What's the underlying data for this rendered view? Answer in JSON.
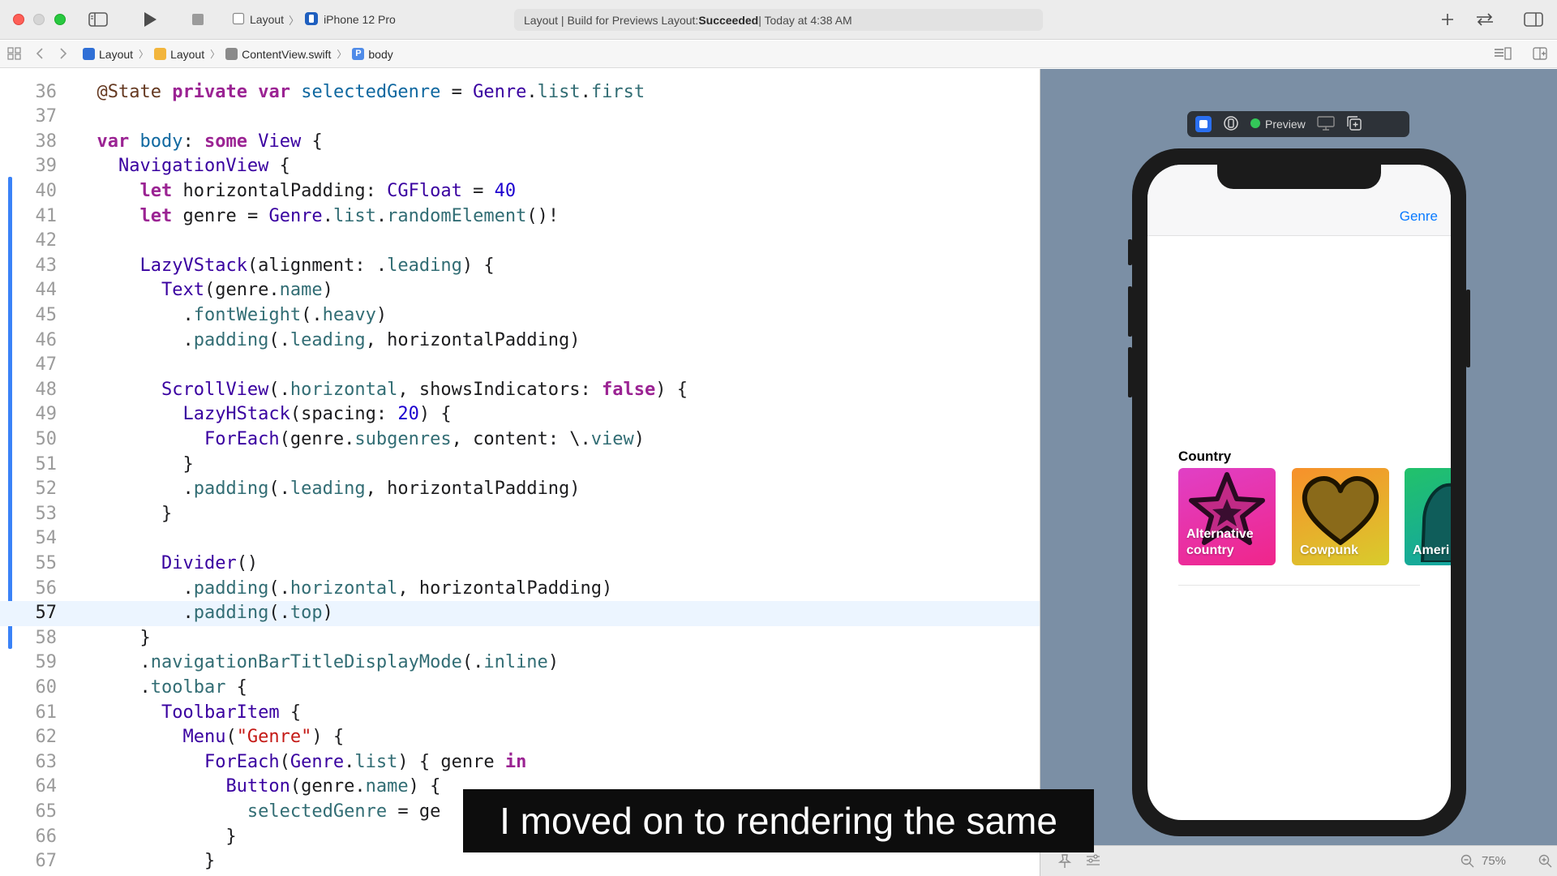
{
  "toolbar": {
    "scheme_project": "Layout",
    "scheme_device": "iPhone 12 Pro",
    "activity_prefix": "Layout | Build for Previews Layout: ",
    "activity_status": "Succeeded",
    "activity_suffix": " | Today at 4:38 AM"
  },
  "breadcrumb": {
    "project": "Layout",
    "folder": "Layout",
    "file": "ContentView.swift",
    "symbol": "body"
  },
  "editor": {
    "current_line": "57",
    "lines": [
      {
        "num": "36",
        "tokens": [
          {
            "t": "  "
          },
          {
            "t": "@State",
            "c": "attr"
          },
          {
            "t": " "
          },
          {
            "t": "private",
            "c": "kw"
          },
          {
            "t": " "
          },
          {
            "t": "var",
            "c": "kw"
          },
          {
            "t": " "
          },
          {
            "t": "selectedGenre",
            "c": "decl"
          },
          {
            "t": " = "
          },
          {
            "t": "Genre",
            "c": "type"
          },
          {
            "t": "."
          },
          {
            "t": "list",
            "c": "prop"
          },
          {
            "t": "."
          },
          {
            "t": "first",
            "c": "prop"
          }
        ]
      },
      {
        "num": "37",
        "tokens": []
      },
      {
        "num": "38",
        "tokens": [
          {
            "t": "  "
          },
          {
            "t": "var",
            "c": "kw"
          },
          {
            "t": " "
          },
          {
            "t": "body",
            "c": "decl"
          },
          {
            "t": ": "
          },
          {
            "t": "some",
            "c": "kw"
          },
          {
            "t": " "
          },
          {
            "t": "View",
            "c": "type"
          },
          {
            "t": " {"
          }
        ]
      },
      {
        "num": "39",
        "tokens": [
          {
            "t": "    "
          },
          {
            "t": "NavigationView",
            "c": "type"
          },
          {
            "t": " {"
          }
        ]
      },
      {
        "num": "40",
        "tokens": [
          {
            "t": "      "
          },
          {
            "t": "let",
            "c": "kw"
          },
          {
            "t": " horizontalPadding: "
          },
          {
            "t": "CGFloat",
            "c": "type"
          },
          {
            "t": " = "
          },
          {
            "t": "40",
            "c": "num"
          }
        ]
      },
      {
        "num": "41",
        "tokens": [
          {
            "t": "      "
          },
          {
            "t": "let",
            "c": "kw"
          },
          {
            "t": " genre = "
          },
          {
            "t": "Genre",
            "c": "type"
          },
          {
            "t": "."
          },
          {
            "t": "list",
            "c": "prop"
          },
          {
            "t": "."
          },
          {
            "t": "randomElement",
            "c": "fn"
          },
          {
            "t": "()!"
          }
        ]
      },
      {
        "num": "42",
        "tokens": []
      },
      {
        "num": "43",
        "tokens": [
          {
            "t": "      "
          },
          {
            "t": "LazyVStack",
            "c": "type"
          },
          {
            "t": "(alignment: ."
          },
          {
            "t": "leading",
            "c": "prop"
          },
          {
            "t": ") {"
          }
        ]
      },
      {
        "num": "44",
        "tokens": [
          {
            "t": "        "
          },
          {
            "t": "Text",
            "c": "type"
          },
          {
            "t": "(genre."
          },
          {
            "t": "name",
            "c": "prop"
          },
          {
            "t": ")"
          }
        ]
      },
      {
        "num": "45",
        "tokens": [
          {
            "t": "          ."
          },
          {
            "t": "fontWeight",
            "c": "fn"
          },
          {
            "t": "(."
          },
          {
            "t": "heavy",
            "c": "prop"
          },
          {
            "t": ")"
          }
        ]
      },
      {
        "num": "46",
        "tokens": [
          {
            "t": "          ."
          },
          {
            "t": "padding",
            "c": "fn"
          },
          {
            "t": "(."
          },
          {
            "t": "leading",
            "c": "prop"
          },
          {
            "t": ", horizontalPadding)"
          }
        ]
      },
      {
        "num": "47",
        "tokens": []
      },
      {
        "num": "48",
        "tokens": [
          {
            "t": "        "
          },
          {
            "t": "ScrollView",
            "c": "type"
          },
          {
            "t": "(."
          },
          {
            "t": "horizontal",
            "c": "prop"
          },
          {
            "t": ", showsIndicators: "
          },
          {
            "t": "false",
            "c": "kw"
          },
          {
            "t": ") {"
          }
        ]
      },
      {
        "num": "49",
        "tokens": [
          {
            "t": "          "
          },
          {
            "t": "LazyHStack",
            "c": "type"
          },
          {
            "t": "(spacing: "
          },
          {
            "t": "20",
            "c": "num"
          },
          {
            "t": ") {"
          }
        ]
      },
      {
        "num": "50",
        "tokens": [
          {
            "t": "            "
          },
          {
            "t": "ForEach",
            "c": "type"
          },
          {
            "t": "(genre."
          },
          {
            "t": "subgenres",
            "c": "prop"
          },
          {
            "t": ", content: \\."
          },
          {
            "t": "view",
            "c": "prop"
          },
          {
            "t": ")"
          }
        ]
      },
      {
        "num": "51",
        "tokens": [
          {
            "t": "          }"
          }
        ]
      },
      {
        "num": "52",
        "tokens": [
          {
            "t": "          ."
          },
          {
            "t": "padding",
            "c": "fn"
          },
          {
            "t": "(."
          },
          {
            "t": "leading",
            "c": "prop"
          },
          {
            "t": ", horizontalPadding)"
          }
        ]
      },
      {
        "num": "53",
        "tokens": [
          {
            "t": "        }"
          }
        ]
      },
      {
        "num": "54",
        "tokens": []
      },
      {
        "num": "55",
        "tokens": [
          {
            "t": "        "
          },
          {
            "t": "Divider",
            "c": "type"
          },
          {
            "t": "()"
          }
        ]
      },
      {
        "num": "56",
        "tokens": [
          {
            "t": "          ."
          },
          {
            "t": "padding",
            "c": "fn"
          },
          {
            "t": "(."
          },
          {
            "t": "horizontal",
            "c": "prop"
          },
          {
            "t": ", horizontalPadding)"
          }
        ]
      },
      {
        "num": "57",
        "tokens": [
          {
            "t": "          ."
          },
          {
            "t": "padding",
            "c": "fn"
          },
          {
            "t": "(."
          },
          {
            "t": "top",
            "c": "prop"
          },
          {
            "t": ")"
          }
        ]
      },
      {
        "num": "58",
        "tokens": [
          {
            "t": "      }"
          }
        ]
      },
      {
        "num": "59",
        "tokens": [
          {
            "t": "      ."
          },
          {
            "t": "navigationBarTitleDisplayMode",
            "c": "fn"
          },
          {
            "t": "(."
          },
          {
            "t": "inline",
            "c": "prop"
          },
          {
            "t": ")"
          }
        ]
      },
      {
        "num": "60",
        "tokens": [
          {
            "t": "      ."
          },
          {
            "t": "toolbar",
            "c": "fn"
          },
          {
            "t": " {"
          }
        ]
      },
      {
        "num": "61",
        "tokens": [
          {
            "t": "        "
          },
          {
            "t": "ToolbarItem",
            "c": "type"
          },
          {
            "t": " {"
          }
        ]
      },
      {
        "num": "62",
        "tokens": [
          {
            "t": "          "
          },
          {
            "t": "Menu",
            "c": "type"
          },
          {
            "t": "("
          },
          {
            "t": "\"Genre\"",
            "c": "str"
          },
          {
            "t": ") {"
          }
        ]
      },
      {
        "num": "63",
        "tokens": [
          {
            "t": "            "
          },
          {
            "t": "ForEach",
            "c": "type"
          },
          {
            "t": "("
          },
          {
            "t": "Genre",
            "c": "type"
          },
          {
            "t": "."
          },
          {
            "t": "list",
            "c": "prop"
          },
          {
            "t": ") { genre "
          },
          {
            "t": "in",
            "c": "kw"
          }
        ]
      },
      {
        "num": "64",
        "tokens": [
          {
            "t": "              "
          },
          {
            "t": "Button",
            "c": "type"
          },
          {
            "t": "(genre."
          },
          {
            "t": "name",
            "c": "prop"
          },
          {
            "t": ") {"
          }
        ]
      },
      {
        "num": "65",
        "tokens": [
          {
            "t": "                "
          },
          {
            "t": "selectedGenre",
            "c": "prop"
          },
          {
            "t": " = ge"
          }
        ]
      },
      {
        "num": "66",
        "tokens": [
          {
            "t": "              }"
          }
        ]
      },
      {
        "num": "67",
        "tokens": [
          {
            "t": "            }"
          }
        ]
      }
    ]
  },
  "preview": {
    "mode_label": "Preview",
    "nav_menu_label": "Genre",
    "genre_heading": "Country",
    "subgenres": [
      {
        "label": "Alternative\ncountry",
        "color_top": "#e040c6",
        "color_bottom": "#f0258a",
        "icon": "star-icon"
      },
      {
        "label": "Cowpunk",
        "color_top": "#f7902b",
        "color_bottom": "#d8cc2c",
        "icon": "heart-icon"
      },
      {
        "label": "Ameri",
        "color_top": "#22c26a",
        "color_bottom": "#14a6a0",
        "icon": "dinosaur-icon"
      }
    ],
    "zoom_label": "75%"
  },
  "caption": "I moved on to rendering the same"
}
